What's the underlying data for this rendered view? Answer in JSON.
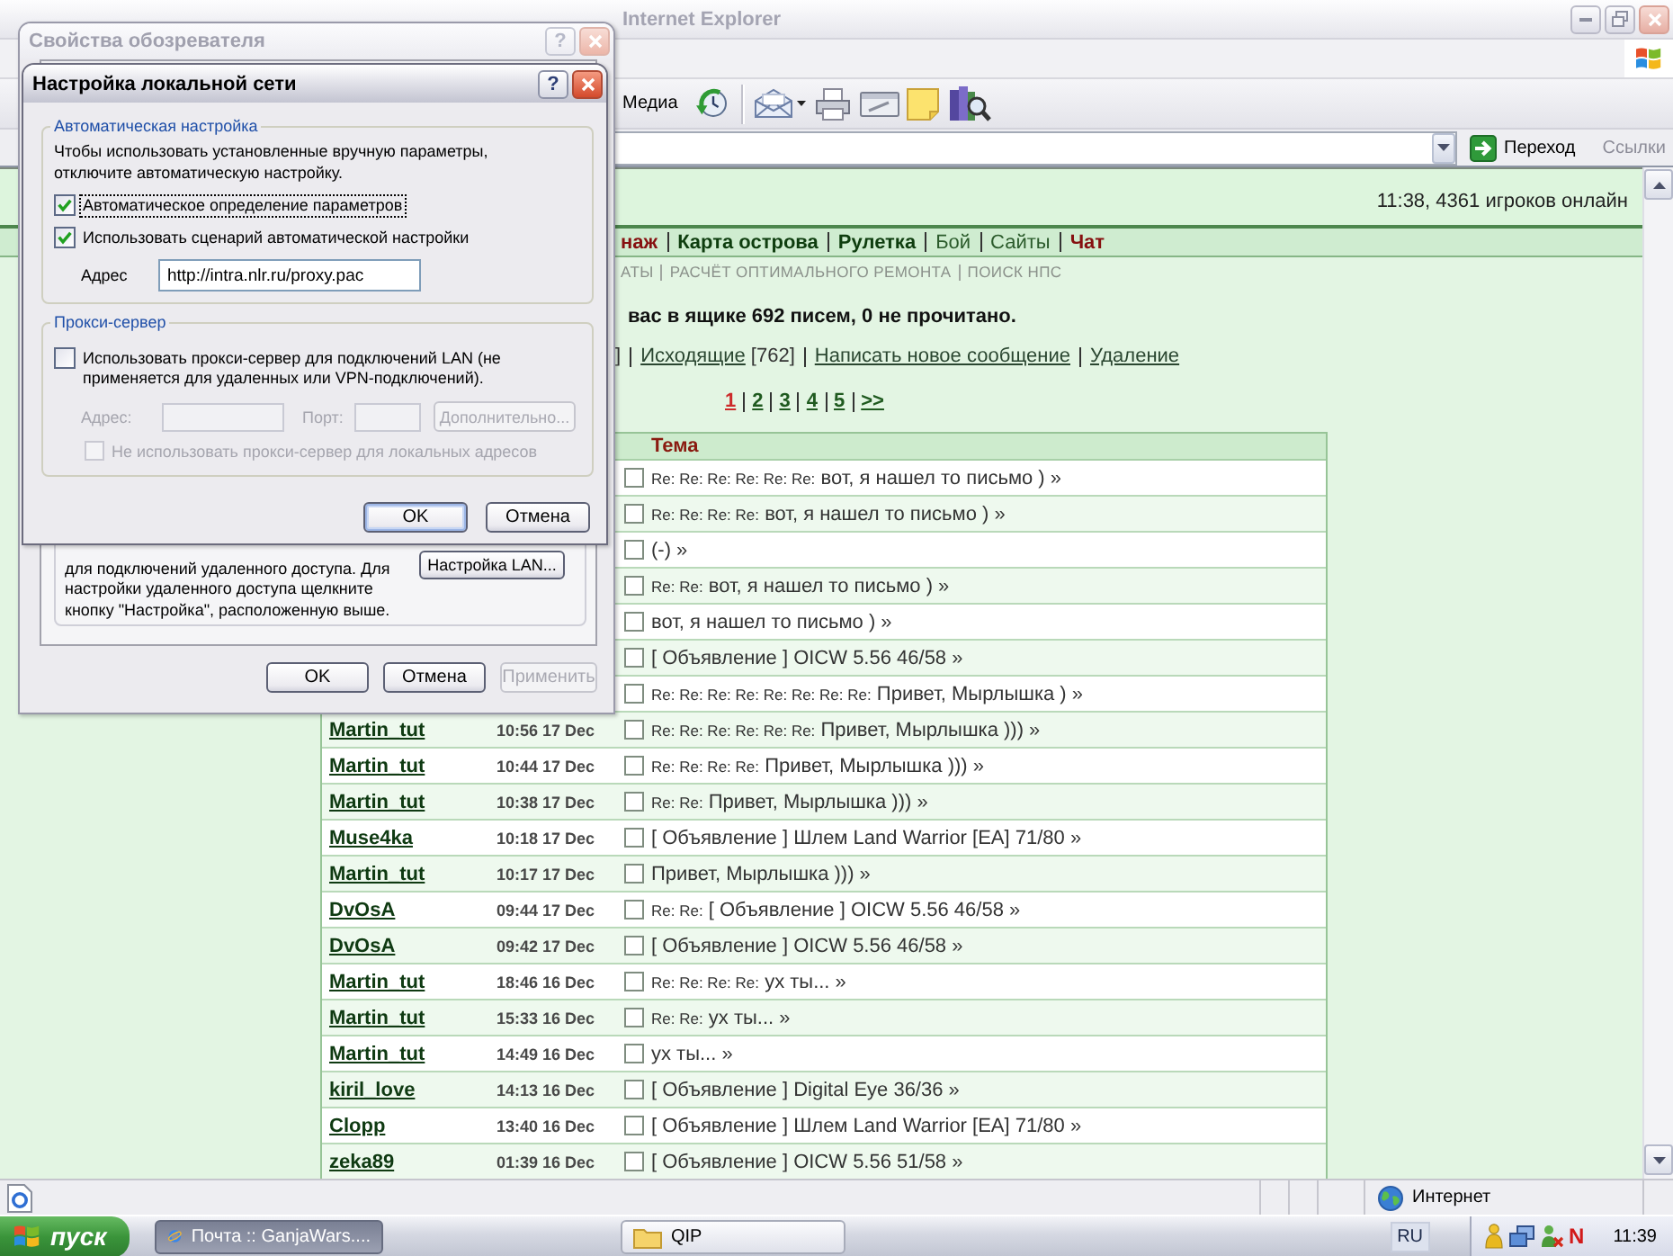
{
  "browser": {
    "title": "Internet Explorer",
    "active": false,
    "toolbar": {
      "media_label": "Медиа"
    },
    "address_bar": {
      "go_label": "Переход",
      "links_label": "Ссылки"
    },
    "status_bar": {
      "zone": "Интернет"
    }
  },
  "page": {
    "online": "11:38, 4361 игроков онлайн",
    "nav": [
      {
        "label": "наж",
        "kind": "hot"
      },
      {
        "label": "Карта острова",
        "kind": "strong"
      },
      {
        "label": "Рулетка",
        "kind": "strong"
      },
      {
        "label": "Бой",
        "kind": "plain"
      },
      {
        "label": "Сайты",
        "kind": "plain"
      },
      {
        "label": "Чат",
        "kind": "hot"
      }
    ],
    "subnav": [
      "АТЫ",
      "РАСЧЁТ ОПТИМАЛЬНОГО РЕМОНТА",
      "ПОИСК НПС"
    ],
    "mailbox_summary": "вас в ящике 692 писем, 0 не прочитано.",
    "folders": {
      "lead": "]",
      "links": [
        {
          "label": "Исходящие",
          "count": "[762]"
        },
        {
          "label": "Написать новое сообщение"
        },
        {
          "label": "Удаление"
        }
      ]
    },
    "pages": [
      {
        "label": "1",
        "selected": true
      },
      {
        "label": "2",
        "selected": false
      },
      {
        "label": "3",
        "selected": false
      },
      {
        "label": "4",
        "selected": false
      },
      {
        "label": "5",
        "selected": false
      },
      {
        "label": ">>",
        "selected": false
      }
    ],
    "table": {
      "heading": "Тема",
      "rows": [
        {
          "prefix": "Re: Re: Re: Re: Re: Re:",
          "text": "вот, я нашел то письмо ) »",
          "checked": false
        },
        {
          "prefix": "Re: Re: Re: Re:",
          "text": "вот, я нашел то письмо ) »",
          "checked": false
        },
        {
          "text": "(-) »",
          "checked": false
        },
        {
          "prefix": "Re: Re:",
          "text": "вот, я нашел то письмо ) »",
          "checked": false
        },
        {
          "text": "вот, я нашел то письмо ) »",
          "checked": false
        },
        {
          "text": "[ Объявление ] OICW 5.56 46/58 »",
          "checked": false
        },
        {
          "prefix": "Re: Re: Re: Re: Re: Re: Re: Re:",
          "text": "Привет, Мырлышка ) »",
          "checked": false
        },
        {
          "author": "Martin_tut",
          "time": "10:56 17 Dec",
          "prefix": "Re: Re: Re: Re: Re: Re:",
          "text": "Привет, Мырлышка ))) »",
          "checked": false
        },
        {
          "author": "Martin_tut",
          "time": "10:44 17 Dec",
          "prefix": "Re: Re: Re: Re:",
          "text": "Привет, Мырлышка ))) »",
          "checked": false
        },
        {
          "author": "Martin_tut",
          "time": "10:38 17 Dec",
          "prefix": "Re: Re:",
          "text": "Привет, Мырлышка ))) »",
          "checked": false
        },
        {
          "author": "Muse4ka",
          "time": "10:18 17 Dec",
          "text": "[ Объявление ] Шлем Land Warrior [EA] 71/80 »",
          "checked": false
        },
        {
          "author": "Martin_tut",
          "time": "10:17 17 Dec",
          "text": "Привет, Мырлышка ))) »",
          "checked": false
        },
        {
          "author": "DvOsA",
          "time": "09:44 17 Dec",
          "prefix": "Re: Re:",
          "text": "[ Объявление ] OICW 5.56 46/58 »",
          "checked": false
        },
        {
          "author": "DvOsA",
          "time": "09:42 17 Dec",
          "text": "[ Объявление ] OICW 5.56 46/58 »",
          "checked": false
        },
        {
          "author": "Martin_tut",
          "time": "18:46 16 Dec",
          "prefix": "Re: Re: Re: Re:",
          "text": "ух ты... »",
          "checked": false
        },
        {
          "author": "Martin_tut",
          "time": "15:33 16 Dec",
          "prefix": "Re: Re:",
          "text": "ух ты... »",
          "checked": false
        },
        {
          "author": "Martin_tut",
          "time": "14:49 16 Dec",
          "text": "ух ты... »",
          "checked": false
        },
        {
          "author": "kiril_love",
          "time": "14:13 16 Dec",
          "text": "[ Объявление ] Digital Eye 36/36 »",
          "checked": false
        },
        {
          "author": "Clopp",
          "time": "13:40 16 Dec",
          "text": "[ Объявление ] Шлем Land Warrior [EA] 71/80 »",
          "checked": false
        },
        {
          "author": "zeka89",
          "time": "01:39 16 Dec",
          "text": "[ Объявление ] OICW 5.56 51/58 »",
          "checked": false
        }
      ]
    }
  },
  "options_dialog": {
    "title": "Свойства обозревателя",
    "active": false,
    "help": "?",
    "note": "для подключений удаленного доступа. Для настройки удаленного доступа щелкните кнопку \"Настройка\", расположенную выше.",
    "lan_button": "Настройка LAN...",
    "buttons": [
      {
        "label": "OK",
        "disabled": false
      },
      {
        "label": "Отмена",
        "disabled": false
      },
      {
        "label": "Применить",
        "disabled": true
      }
    ]
  },
  "lan_dialog": {
    "title": "Настройка локальной сети",
    "active": true,
    "help": "?",
    "auto": {
      "title": "Автоматическая настройка",
      "hint": "Чтобы использовать установленные вручную параметры, отключите автоматическую настройку.",
      "options": [
        {
          "label": "Автоматическое определение параметров",
          "checked": true,
          "focused": true
        },
        {
          "label": "Использовать сценарий автоматической настройки",
          "checked": true,
          "focused": false
        }
      ],
      "address_label": "Адрес",
      "address_value": "http://intra.nlr.ru/proxy.pac"
    },
    "proxy": {
      "title": "Прокси-сервер",
      "disabled": true,
      "use_proxy": {
        "label": "Использовать прокси-сервер для подключений LAN (не применяется для удаленных или VPN-подключений).",
        "checked": false
      },
      "address_label": "Адрес:",
      "port_label": "Порт:",
      "advanced_label": "Дополнительно...",
      "bypass": {
        "label": "Не использовать прокси-сервер для локальных адресов",
        "checked": false
      }
    },
    "buttons": [
      {
        "label": "OK",
        "default": true
      },
      {
        "label": "Отмена",
        "default": false
      }
    ]
  },
  "taskbar": {
    "start_label": "пуск",
    "tasks": [
      {
        "label": "Почта :: GanjaWars....",
        "selected": true
      },
      {
        "label": "QIP",
        "selected": false
      }
    ],
    "language": "RU",
    "tray_mark": "N",
    "clock": "11:39"
  }
}
